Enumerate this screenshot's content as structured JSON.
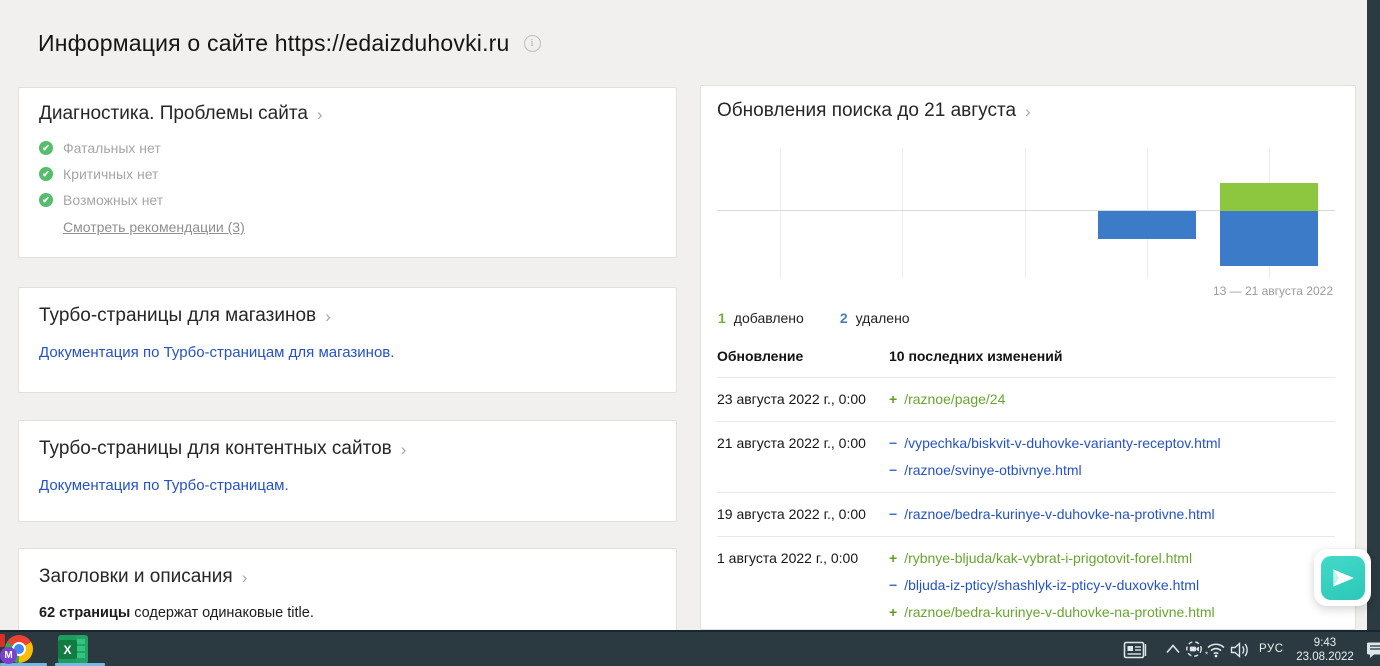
{
  "page": {
    "title": "Информация о сайте https://edaizduhovki.ru"
  },
  "left_column": {
    "diagnostics": {
      "title": "Диагностика. Проблемы сайта",
      "items": [
        "Фатальных нет",
        "Критичных нет",
        "Возможных нет"
      ],
      "link": "Смотреть рекомендации (3)"
    },
    "turbo_shops": {
      "title": "Турбо-страницы для магазинов",
      "link": "Документация по Турбо-страницам для магазинов."
    },
    "turbo_content": {
      "title": "Турбо-страницы для контентных сайтов",
      "link": "Документация по Турбо-страницам."
    },
    "titles": {
      "title": "Заголовки и описания",
      "bold_text": "62 страницы",
      "rest_text": " содержат одинаковые title."
    }
  },
  "right_column": {
    "title": "Обновления поиска до 21 августа",
    "chart_caption": "13 — 21 августа 2022",
    "legend": {
      "added_value": "1",
      "added_label": "добавлено",
      "deleted_value": "2",
      "deleted_label": "удалено"
    },
    "table": {
      "col_update": "Обновление",
      "col_changes": "10 последних изменений",
      "rows": [
        {
          "date": "23 августа 2022 г., 0:00",
          "changes": [
            {
              "sign": "+",
              "type": "added",
              "path": "/raznoe/page/24"
            }
          ]
        },
        {
          "date": "21 августа 2022 г., 0:00",
          "changes": [
            {
              "sign": "−",
              "type": "deleted",
              "path": "/vypechka/biskvit-v-duhovke-varianty-receptov.html"
            },
            {
              "sign": "−",
              "type": "deleted",
              "path": "/raznoe/svinye-otbivnye.html"
            }
          ]
        },
        {
          "date": "19 августа 2022 г., 0:00",
          "changes": [
            {
              "sign": "−",
              "type": "deleted",
              "path": "/raznoe/bedra-kurinye-v-duhovke-na-protivne.html"
            }
          ]
        },
        {
          "date": "1 августа 2022 г., 0:00",
          "changes": [
            {
              "sign": "+",
              "type": "added",
              "path": "/rybnye-bljuda/kak-vybrat-i-prigotovit-forel.html"
            },
            {
              "sign": "−",
              "type": "deleted",
              "path": "/bljuda-iz-pticy/shashlyk-iz-pticy-v-duxovke.html"
            },
            {
              "sign": "+",
              "type": "added",
              "path": "/raznoe/bedra-kurinye-v-duhovke-na-protivne.html"
            }
          ]
        }
      ]
    }
  },
  "chart_data": {
    "type": "bar",
    "title": "Обновления поиска до 21 августа",
    "x_slots": 5,
    "caption": "13 — 21 августа 2022",
    "baseline": "zero; added plotted above axis, deleted below",
    "grid": "vertical gridlines only",
    "ylim": [
      -2,
      1
    ],
    "series": [
      {
        "name": "добавлено",
        "color": "#8dc63f",
        "values": [
          0,
          0,
          0,
          0,
          1
        ]
      },
      {
        "name": "удалено",
        "color": "#3b7bc8",
        "values": [
          0,
          0,
          0,
          1,
          2
        ]
      }
    ]
  },
  "taskbar": {
    "language": "РУС",
    "time": "9:43",
    "date": "23.08.2022",
    "pinned_apps": [
      "chrome",
      "excel"
    ],
    "tray_icons": [
      "news-icon",
      "chevron-up-icon",
      "meet-now-icon",
      "wifi-icon",
      "volume-icon",
      "action-center-icon"
    ]
  },
  "colors": {
    "page_bg": "#f1f0ee",
    "link_blue": "#2452c6",
    "added_green": "#67a52f",
    "bar_added": "#8dc63f",
    "bar_deleted": "#3b7bc8",
    "check_green": "#55bd6c",
    "widget_teal": "#35d1c0",
    "taskbar_bg": "#2b3940"
  }
}
